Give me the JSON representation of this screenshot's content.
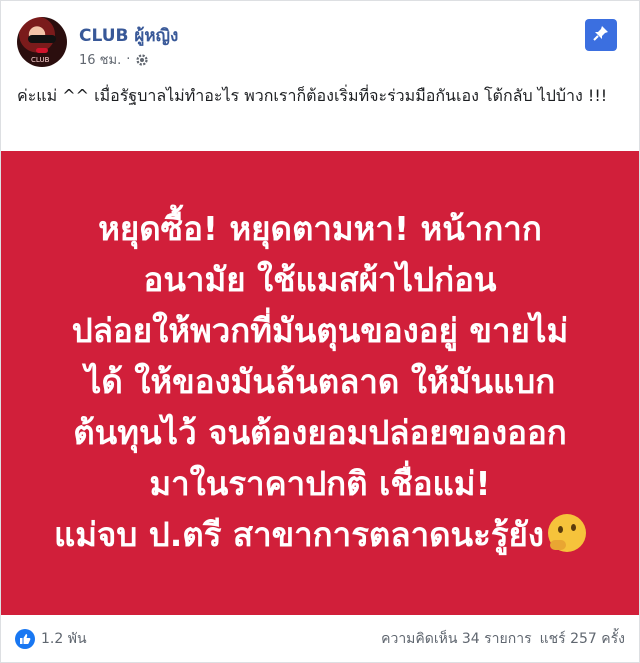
{
  "post": {
    "page_name": "CLUB ผู้หญิง",
    "time": "16 ชม.",
    "separator": "·",
    "caption": "ค่ะแม่ ^^ เมื่อรัฐบาลไม่ทำอะไร พวกเราก็ต้องเริ่มที่จะร่วมมือกันเอง โต้กลับ ไปบ้าง !!!",
    "image_text_lines": [
      "หยุดซื้อ! หยุดตามหา! หน้ากาก",
      "อนามัย ใช้แมสผ้าไปก่อน",
      "ปล่อยให้พวกที่มันตุนของอยู่ ขายไม่",
      "ได้ ให้ของมันล้นตลาด ให้มันแบก",
      "ต้นทุนไว้ จนต้องยอมปล่อยของออก",
      "มาในราคาปกติ เชื่อแม่!",
      "แม่จบ ป.ตรี สาขาการตลาดนะรู้ยัง"
    ],
    "avatar_label": "CLUB"
  },
  "footer": {
    "reaction_count": "1.2 พัน",
    "comments": "ความคิดเห็น 34 รายการ",
    "shares": "แชร์ 257 ครั้ง"
  },
  "colors": {
    "banner_bg": "#d11f3a",
    "link": "#385898",
    "pin_bg": "#3b6fe0",
    "like_blue": "#1877f2"
  },
  "icons": [
    "gear-icon",
    "pin-icon",
    "like-icon",
    "thinking-face-emoji"
  ]
}
